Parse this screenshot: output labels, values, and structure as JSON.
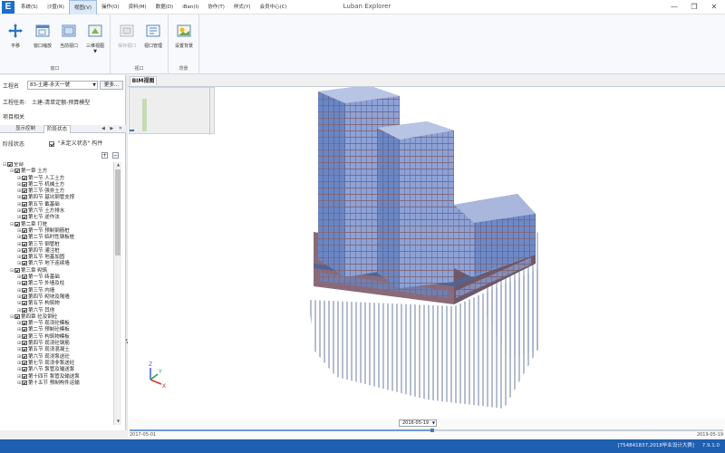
{
  "window": {
    "title": "Luban Explorer",
    "logo_text": "E",
    "minimize": "—",
    "maximize": "❐",
    "close": "✕"
  },
  "menu": [
    {
      "label": "系统(S)",
      "active": false
    },
    {
      "label": "沙盘(R)",
      "active": false
    },
    {
      "label": "视图(V)",
      "active": true
    },
    {
      "label": "操作(O)",
      "active": false
    },
    {
      "label": "资料(M)",
      "active": false
    },
    {
      "label": "数据(D)",
      "active": false
    },
    {
      "label": "iBan(I)",
      "active": false
    },
    {
      "label": "协作(T)",
      "active": false
    },
    {
      "label": "样式(Y)",
      "active": false
    },
    {
      "label": "会员中心(C)",
      "active": false
    }
  ],
  "ribbon": {
    "groups": [
      {
        "label": "窗口",
        "buttons": [
          {
            "label": "平移",
            "icon": "pan-icon",
            "enabled": true
          },
          {
            "label": "窗口缩放",
            "icon": "window-zoom-icon",
            "enabled": true
          },
          {
            "label": "当前视口",
            "icon": "current-viewport-icon",
            "enabled": true
          },
          {
            "label": "三维视图",
            "icon": "3d-view-icon",
            "enabled": true
          }
        ]
      },
      {
        "label": "视口",
        "buttons": [
          {
            "label": "保存视口",
            "icon": "save-viewport-icon",
            "enabled": false
          },
          {
            "label": "视口管理",
            "icon": "viewport-manage-icon",
            "enabled": true
          }
        ]
      },
      {
        "label": "背景",
        "buttons": [
          {
            "label": "设置背景",
            "icon": "set-background-icon",
            "enabled": true
          }
        ]
      }
    ]
  },
  "project": {
    "name_label": "工程名",
    "name_value": "83-土建-永天一號",
    "more_label": "更多...",
    "task_label": "工程任务:",
    "task_value": "土建-清单定额-预算模型",
    "related_label": "项目相关"
  },
  "panel_tabs": [
    {
      "label": "显示控制",
      "active": false
    },
    {
      "label": "阶段状态",
      "active": true
    }
  ],
  "panel_tab_arrows": "◀ ▶ ✕",
  "stage": {
    "label": "阶段状态",
    "checkbox_label": "\"未定义状态\" 构件",
    "plus": "+",
    "minus": "−"
  },
  "tree": [
    {
      "level": 0,
      "label": "全部",
      "expanded": true
    },
    {
      "level": 1,
      "label": "第一章  土方",
      "expanded": true
    },
    {
      "level": 2,
      "label": "第一节  人工土方"
    },
    {
      "level": 2,
      "label": "第二节  机械土方"
    },
    {
      "level": 2,
      "label": "第三节  强夯土方"
    },
    {
      "level": 2,
      "label": "第四节  基坑钢管支撑"
    },
    {
      "level": 2,
      "label": "第五节  截基础"
    },
    {
      "level": 2,
      "label": "第六节  土方排水"
    },
    {
      "level": 2,
      "label": "第七节  逆作法"
    },
    {
      "level": 1,
      "label": "第二章  打桩",
      "expanded": true
    },
    {
      "level": 2,
      "label": "第一节  预制钢筋桩"
    },
    {
      "level": 2,
      "label": "第二节  临时性钢板桩"
    },
    {
      "level": 2,
      "label": "第三节  钢管桩"
    },
    {
      "level": 2,
      "label": "第四节  灌注桩"
    },
    {
      "level": 2,
      "label": "第五节  地基加固"
    },
    {
      "level": 2,
      "label": "第六节  地下连续墙"
    },
    {
      "level": 1,
      "label": "第三章  砌筑",
      "expanded": true
    },
    {
      "level": 2,
      "label": "第一节  砖基础"
    },
    {
      "level": 2,
      "label": "第二节  外墙及柱"
    },
    {
      "level": 2,
      "label": "第三节  内墙"
    },
    {
      "level": 2,
      "label": "第四节  砌块及隔墙"
    },
    {
      "level": 2,
      "label": "第五节  构筑物"
    },
    {
      "level": 2,
      "label": "第六节  其他"
    },
    {
      "level": 1,
      "label": "第四章  砼及钢砼",
      "expanded": true
    },
    {
      "level": 2,
      "label": "第一节  现浇砼模板"
    },
    {
      "level": 2,
      "label": "第二节  预制砼模板"
    },
    {
      "level": 2,
      "label": "第三节  构筑物模板"
    },
    {
      "level": 2,
      "label": "第四节  现浇砼钢筋"
    },
    {
      "level": 2,
      "label": "第五节  现浇混凝土"
    },
    {
      "level": 2,
      "label": "第六节  现浇泵送砼"
    },
    {
      "level": 2,
      "label": "第七节  现浇非泵送砼"
    },
    {
      "level": 2,
      "label": "第八节  泵管及输送泵"
    },
    {
      "level": 2,
      "label": "第十四节  泵管及输送泵"
    },
    {
      "level": 2,
      "label": "第十五节  预制构件运输"
    }
  ],
  "viewport": {
    "tab_label": "BIM视图",
    "axis_x": "X",
    "axis_y": "Y",
    "axis_z": "Z"
  },
  "timeline": {
    "current_date": "2016-05-19",
    "start_date": "2017-05-01",
    "end_date": "2019-05-19",
    "progress": 0.51
  },
  "status": {
    "user": "[754841837,2018毕业设计大赛]",
    "version": "7.9.1.0"
  },
  "colors": {
    "statusbar": "#1f5fb1",
    "building_glass": "#6b86c4",
    "building_slab": "#8a6a78",
    "piles": "#5b6f98",
    "accent": "#1c6fc9"
  }
}
